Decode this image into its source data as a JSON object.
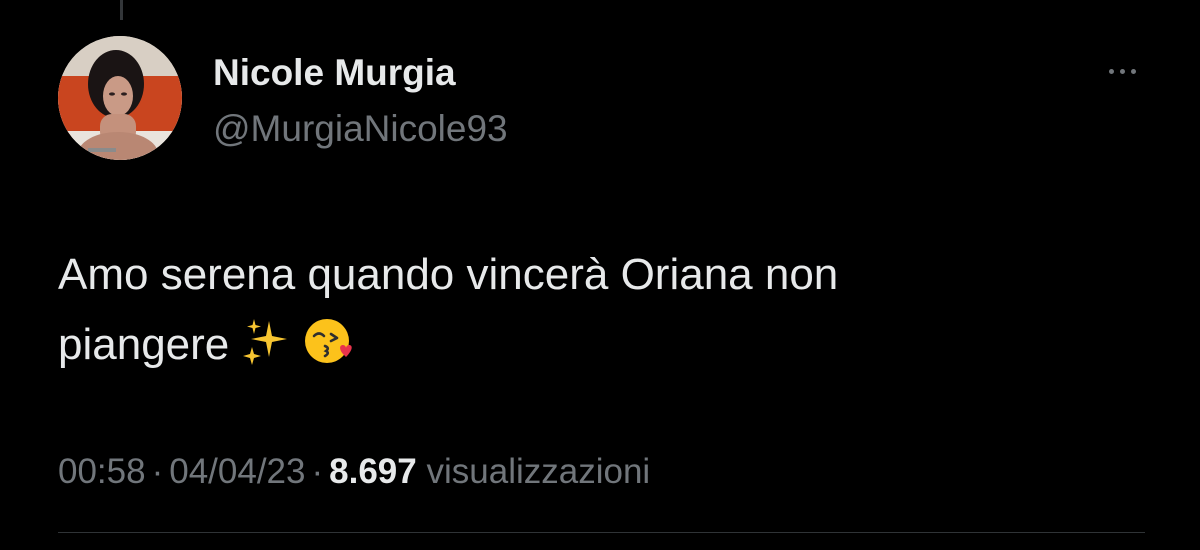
{
  "tweet": {
    "author": {
      "display_name": "Nicole Murgia",
      "handle": "@MurgiaNicole93",
      "avatar": "profile-photo"
    },
    "text_lines": [
      "Amo serena quando vincerà Oriana non",
      "piangere"
    ],
    "emojis": [
      "sparkles-emoji",
      "face-blowing-kiss-emoji"
    ],
    "more_icon": "more-horizontal-icon",
    "meta": {
      "time": "00:58",
      "date": "04/04/23",
      "separator": "·",
      "views_count": "8.697",
      "views_label": "visualizzazioni"
    }
  },
  "colors": {
    "background": "#000000",
    "primary_text": "#e7e9ea",
    "secondary_text": "#71767b",
    "divider": "#2f3336"
  }
}
